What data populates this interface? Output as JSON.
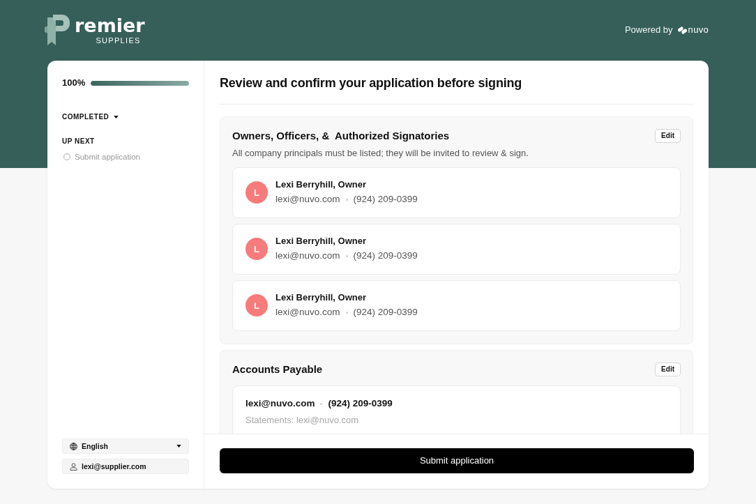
{
  "header": {
    "logo": {
      "wordmark": "remier",
      "tagline": "SUPPLIES"
    },
    "powered_by": {
      "label": "Powered by",
      "brand": "nuvo"
    }
  },
  "sidebar": {
    "progress": {
      "percent": "100%",
      "level": 1
    },
    "completed": {
      "label": "COMPLETED",
      "expanded": false
    },
    "up_next": {
      "label": "UP NEXT",
      "steps": [
        {
          "label": "Submit application",
          "done": false
        }
      ]
    },
    "language": {
      "value": "English"
    },
    "account": {
      "email": "lexi@supplier.com"
    }
  },
  "main": {
    "title": "Review and confirm your application before signing",
    "sections": [
      {
        "kind": "contacts",
        "title": "Owners, Officers, &  Authorized Signatories",
        "action": "Edit",
        "description": "All company principals must be listed; they will be invited to review & sign.",
        "contacts": [
          {
            "initial": "L",
            "name": "Lexi Berryhill, Owner",
            "email": "lexi@nuvo.com",
            "phone": "(924) 209-0399"
          },
          {
            "initial": "L",
            "name": "Lexi Berryhill, Owner",
            "email": "lexi@nuvo.com",
            "phone": "(924) 209-0399"
          },
          {
            "initial": "L",
            "name": "Lexi Berryhill, Owner",
            "email": "lexi@nuvo.com",
            "phone": "(924) 209-0399"
          }
        ]
      },
      {
        "kind": "payable",
        "title": "Accounts Payable",
        "action": "Edit",
        "contact": {
          "email": "lexi@nuvo.com",
          "phone": "(924) 209-0399",
          "note": "Statements: lexi@nuvo.com"
        }
      }
    ],
    "submit": "Submit application"
  }
}
